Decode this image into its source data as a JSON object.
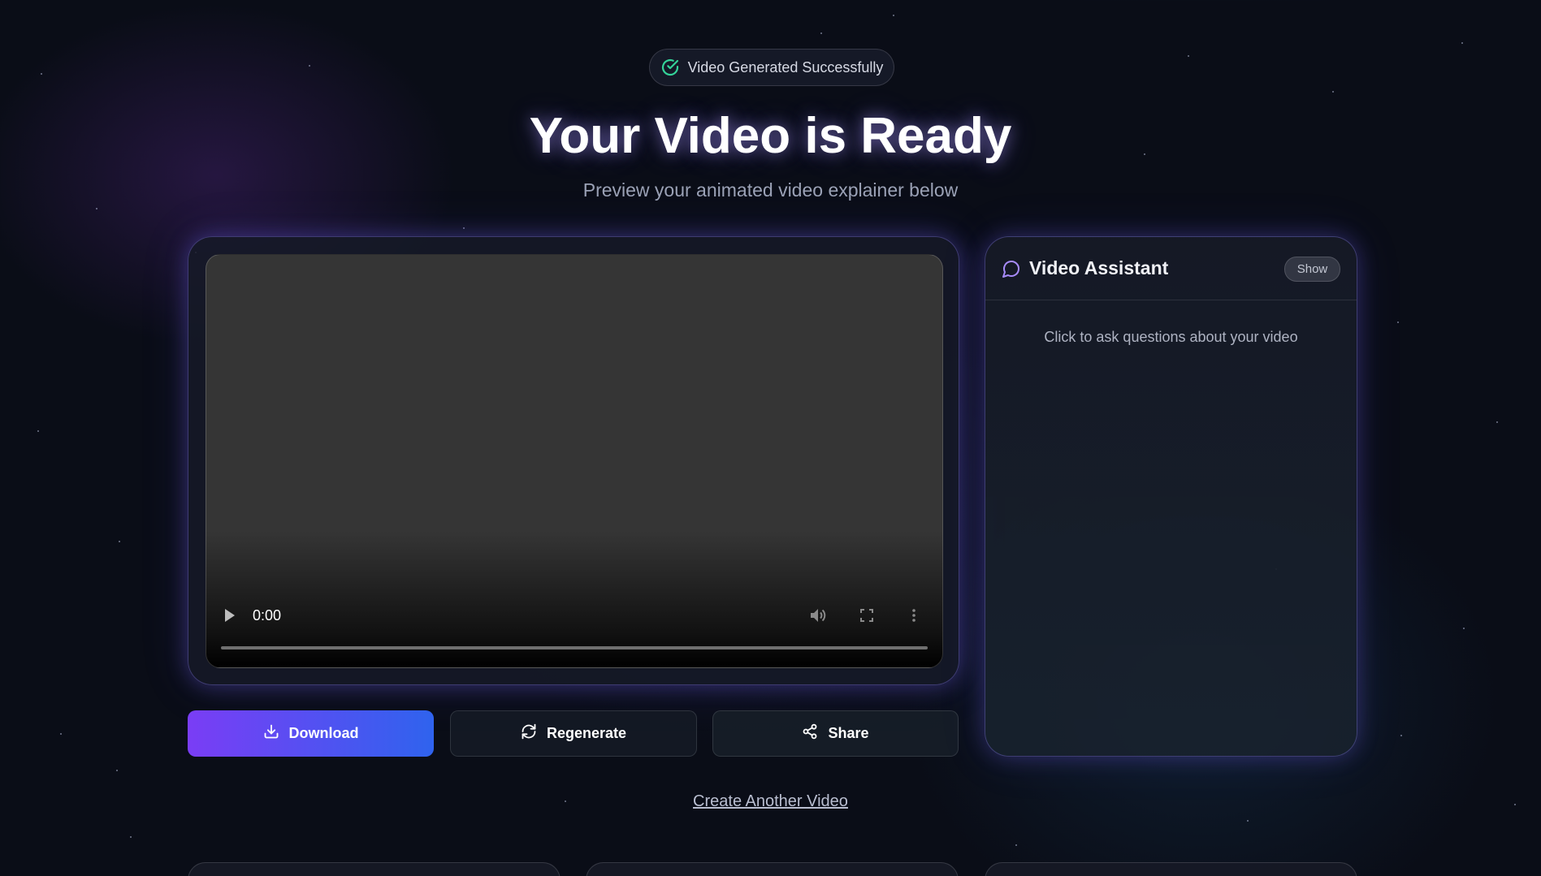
{
  "status_badge": {
    "label": "Video Generated Successfully",
    "icon": "check-circle-icon",
    "color": "#34d399"
  },
  "header": {
    "title": "Your Video is Ready",
    "subtitle": "Preview your animated video explainer below"
  },
  "video_player": {
    "current_time": "0:00",
    "progress": 0,
    "controls": [
      "play-icon",
      "volume-icon",
      "fullscreen-icon",
      "more-options-icon"
    ]
  },
  "actions": {
    "download_label": "Download",
    "regenerate_label": "Regenerate",
    "share_label": "Share",
    "download_gradient": [
      "#7a3df5",
      "#2f63ee"
    ]
  },
  "assistant": {
    "title": "Video Assistant",
    "toggle_label": "Show",
    "hint": "Click to ask questions about your video",
    "icon": "chat-bubble-icon",
    "accent": "#a78bfa"
  },
  "footer": {
    "create_another_label": "Create Another Video"
  }
}
